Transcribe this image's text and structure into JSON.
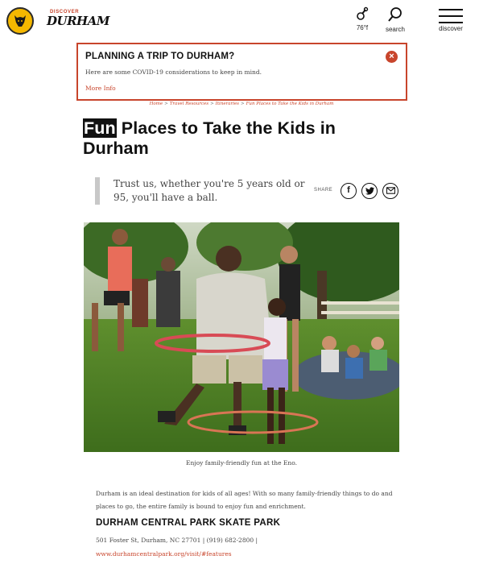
{
  "header": {
    "brand_small": "DISCOVER",
    "brand_big": "DURHAM",
    "weather_label": "76°f",
    "search_label": "search",
    "discover_label": "discover"
  },
  "alert": {
    "title": "PLANNING A TRIP TO DURHAM?",
    "text": "Here are some COVID-19 considerations to keep in mind.",
    "link": "More Info",
    "close_glyph": "×"
  },
  "breadcrumb": [
    "Home",
    "Travel Resources",
    "Itineraries",
    "Fun Places to Take the Kids in Durham"
  ],
  "breadcrumb_sep": ">",
  "article": {
    "title_highlight": "Fun",
    "title_rest": " Places to Take the Kids in Durham",
    "subtitle": "Trust us, whether you're 5 years old or 95, you'll have a ball.",
    "share_label": "SHARE",
    "share_icons": [
      "facebook-icon",
      "twitter-icon",
      "email-icon"
    ],
    "photo_caption": "Enjoy family-friendly fun at the Eno.",
    "intro": "Durham is an ideal destination for kids of all ages! With so many family-friendly things to do and places to go, the entire family is bound to enjoy fun and enrichment.",
    "section_title": "DURHAM CENTRAL PARK SKATE PARK",
    "address": "501 Foster St, Durham, NC 27701 | (919) 682-2800 |",
    "url": "www.durhamcentralpark.org/visit/#features"
  },
  "colors": {
    "accent": "#c8452c",
    "logo_yellow": "#f5b800"
  }
}
